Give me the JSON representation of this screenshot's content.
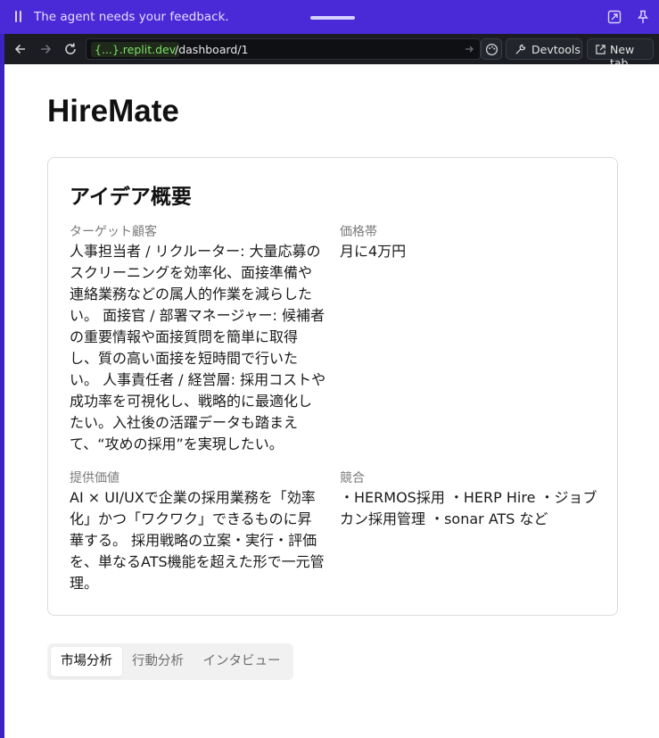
{
  "agent_bar": {
    "message": "The agent needs your feedback.",
    "icons": [
      "pause-icon",
      "drag-handle",
      "expand-icon",
      "pin-icon"
    ]
  },
  "browser": {
    "url_host": "{...}.replit.dev",
    "url_path": "/dashboard/1",
    "devtools_label": "Devtools",
    "new_tab_label": "New tab",
    "icons": [
      "back-arrow-icon",
      "forward-arrow-icon",
      "reload-icon",
      "palette-icon",
      "wrench-icon",
      "external-link-icon"
    ]
  },
  "page": {
    "app_title": "HireMate",
    "overview": {
      "title": "アイデア概要",
      "target": {
        "label": "ターゲット顧客",
        "lines": [
          "人事担当者 / リクルーター: 大量応募の",
          "スクリーニングを効率化、面接準備や",
          "連絡業務などの属人的作業を減らした",
          "い。 面接官 / 部署マネージャー: 候補者",
          "の重要情報や面接質問を簡単に取得",
          "し、質の高い面接を短時間で行いた",
          "い。 人事責任者 / 経営層: 採用コストや",
          "成功率を可視化し、戦略的に最適化し",
          "たい。入社後の活躍データも踏まえ",
          "て、“攻めの採用”を実現したい。"
        ]
      },
      "price": {
        "label": "価格帯",
        "lines": [
          "月に4万円"
        ]
      },
      "value": {
        "label": "提供価値",
        "lines": [
          "AI × UI/UXで企業の採用業務を「効率",
          "化」かつ「ワクワク」できるものに昇",
          "華する。 採用戦略の立案・実行・評価",
          "を、単なるATS機能を超えた形で一元管",
          "理。"
        ]
      },
      "competitors": {
        "label": "競合",
        "lines": [
          "・HERMOS採用 ・HERP Hire ・ジョブ",
          "カン採用管理 ・sonar ATS など"
        ]
      }
    },
    "tabs": [
      {
        "label": "市場分析",
        "active": true
      },
      {
        "label": "行動分析",
        "active": false
      },
      {
        "label": "インタビュー",
        "active": false
      }
    ]
  },
  "colors": {
    "agent_bar": "#4a2ad6",
    "browser_bar": "#1b1d23",
    "url_host": "#7ee06a"
  }
}
